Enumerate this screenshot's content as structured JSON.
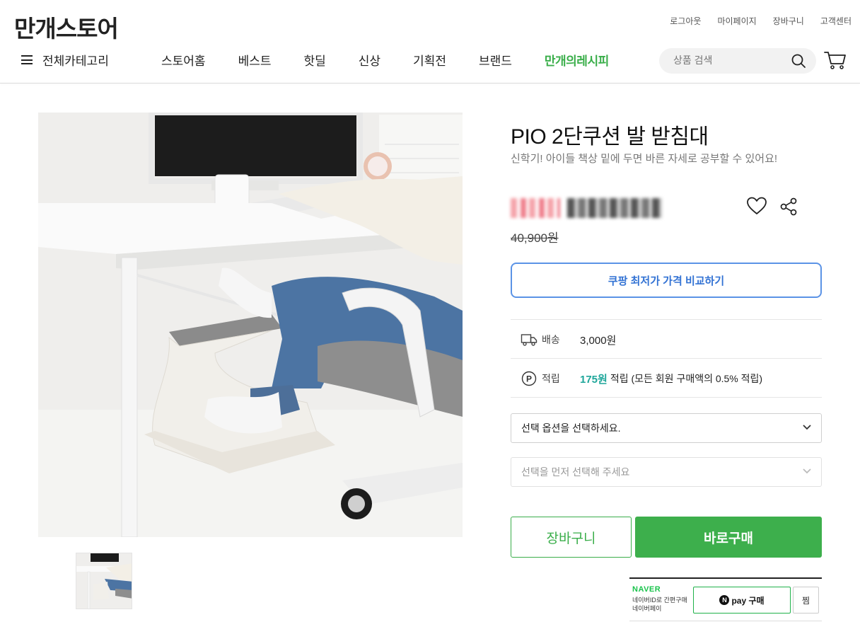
{
  "header": {
    "logo": "만개스토어",
    "util_links": [
      "로그아웃",
      "마이페이지",
      "장바구니",
      "고객센터"
    ],
    "category_label": "전체카테고리",
    "menu": [
      "스토어홈",
      "베스트",
      "핫딜",
      "신상",
      "기획전",
      "브랜드"
    ],
    "recipe_menu": "만개의레시피",
    "search_placeholder": "상품 검색"
  },
  "product": {
    "title": "PIO 2단쿠션 발 받침대",
    "subtitle": "신학기! 아이들 책상 밑에 두면 바른 자세로 공부할 수 있어요!",
    "original_price": "40,900원",
    "compare_button": "쿠팡 최저가 가격 비교하기",
    "shipping_label": "배송",
    "shipping_value": "3,000원",
    "points_label": "적립",
    "points_amount": "175원",
    "points_text": "적립 (모든 회원 구매액의 0.5% 적립)",
    "option1_placeholder": "선택 옵션을 선택하세요.",
    "option2_placeholder": "선택을 먼저 선택해 주세요",
    "cart_button": "장바구니",
    "buy_button": "바로구매"
  },
  "naver": {
    "logo": "NAVER",
    "text": "네이버ID로 간편구매 네이버페이",
    "npay_icon_letter": "N",
    "npay_label": "pay 구매",
    "zzim_label": "찜"
  },
  "colors": {
    "brand_green": "#3aae4a",
    "compare_blue": "#3373d4",
    "points_teal": "#1ea69a",
    "naver_green": "#19c34b"
  }
}
